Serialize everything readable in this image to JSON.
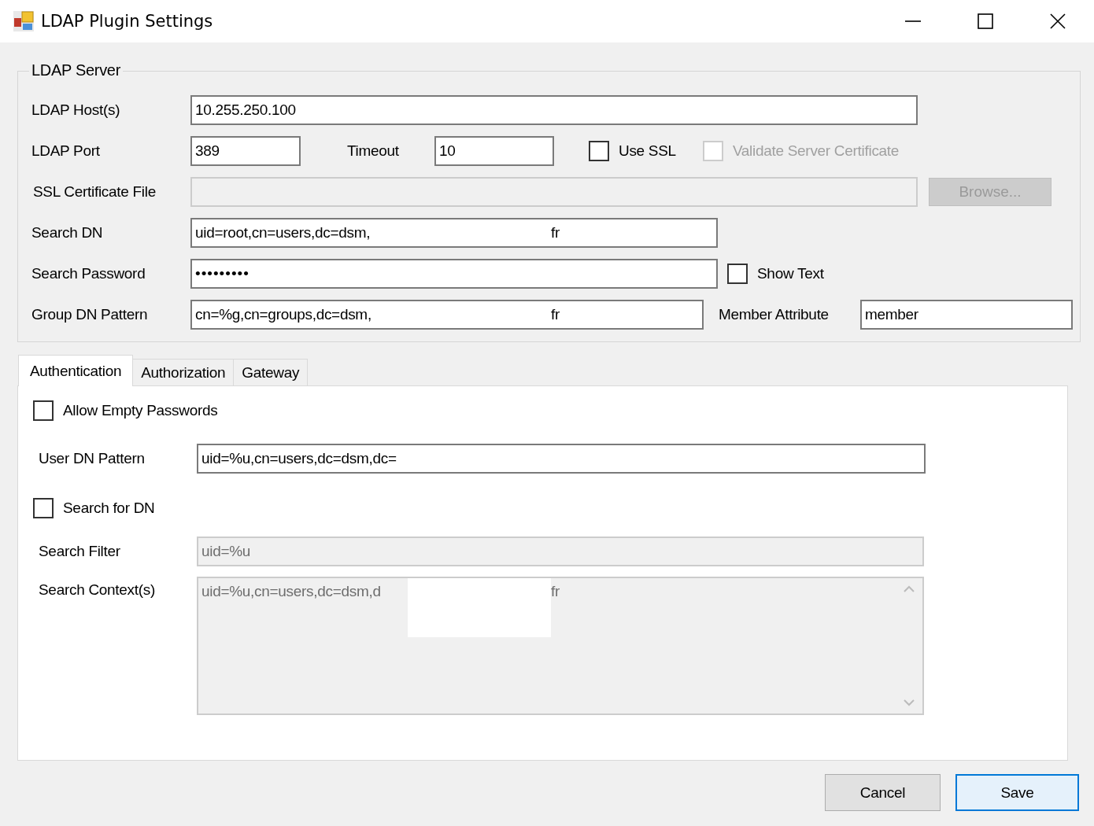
{
  "window": {
    "title": "LDAP Plugin Settings"
  },
  "ldap_server": {
    "legend": "LDAP Server",
    "host": {
      "label": "LDAP Host(s)",
      "value": "10.255.250.100"
    },
    "port": {
      "label": "LDAP Port",
      "value": "389"
    },
    "timeout": {
      "label": "Timeout",
      "value": "10"
    },
    "use_ssl": {
      "label": "Use SSL",
      "checked": false,
      "disabled": false
    },
    "validate_cert": {
      "label": "Validate Server Certificate",
      "checked": false,
      "disabled": true
    },
    "ssl_cert_file": {
      "label": "SSL Certificate File",
      "disabled": true
    },
    "browse_button": {
      "label": "Browse...",
      "disabled": true
    },
    "search_dn": {
      "label": "Search DN",
      "value": "uid=root,cn=users,dc=dsm,",
      "value_end": "fr"
    },
    "search_password": {
      "label": "Search Password",
      "value": "•••••••••"
    },
    "show_text": {
      "label": "Show Text",
      "checked": false,
      "disabled": false
    },
    "group_dn_pattern": {
      "label": "Group DN Pattern",
      "value": "cn=%g,cn=groups,dc=dsm,",
      "value_end": "fr"
    },
    "member_attribute": {
      "label": "Member Attribute",
      "value": "member"
    }
  },
  "tabs": [
    {
      "label": "Authentication",
      "selected": true
    },
    {
      "label": "Authorization",
      "selected": false
    },
    {
      "label": "Gateway",
      "selected": false
    }
  ],
  "authentication": {
    "allow_empty_passwords": {
      "label": "Allow Empty Passwords",
      "checked": false,
      "disabled": false
    },
    "user_dn_pattern": {
      "label": "User DN Pattern",
      "value": "uid=%u,cn=users,dc=dsm,dc="
    },
    "search_for_dn": {
      "label": "Search for DN",
      "checked": false,
      "disabled": false
    },
    "search_filter": {
      "label": "Search Filter",
      "value": "uid=%u",
      "disabled": true
    },
    "search_contexts": {
      "label": "Search Context(s)",
      "value": "uid=%u,cn=users,dc=dsm,d",
      "value_end": "fr",
      "disabled": true
    }
  },
  "buttons": [
    {
      "label": "Cancel",
      "default": false
    },
    {
      "label": "Save",
      "default": true
    }
  ]
}
